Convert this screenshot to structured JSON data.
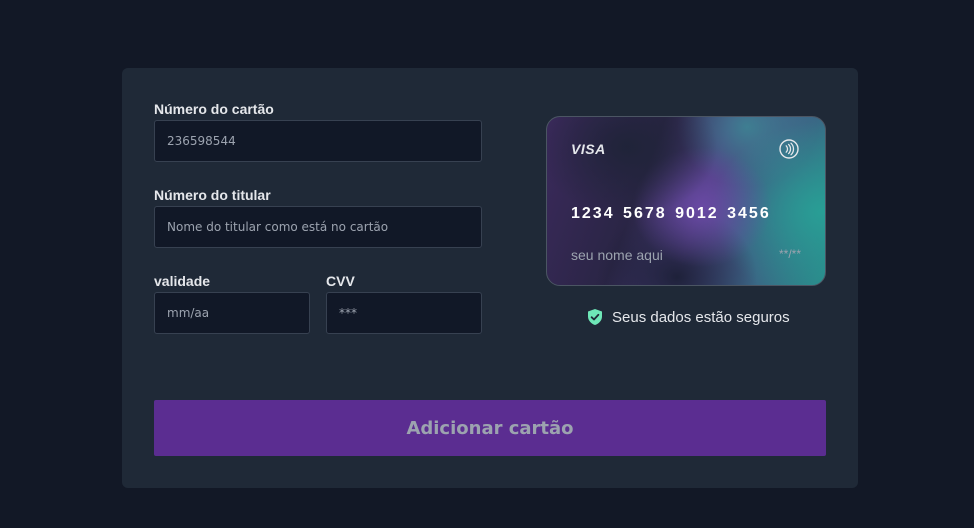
{
  "form": {
    "card_number": {
      "label": "Número do cartão",
      "value": "236598544",
      "placeholder": ""
    },
    "holder": {
      "label": "Número do titular",
      "value": "",
      "placeholder": "Nome do titular como está no cartão"
    },
    "expiry": {
      "label": "validade",
      "value": "",
      "placeholder": "mm/aa"
    },
    "cvv": {
      "label": "CVV",
      "value": "",
      "placeholder": "***"
    }
  },
  "card_preview": {
    "brand": "VISA",
    "number": "1234 5678 9012 3456",
    "holder_name": "seu nome aqui",
    "expiry": "**/**",
    "contactless_icon": "contactless-icon"
  },
  "security": {
    "icon": "shield-check-icon",
    "text": "Seus dados estão seguros",
    "icon_color": "#6ee7b7"
  },
  "submit": {
    "label": "Adicionar cartão"
  },
  "colors": {
    "page_bg": "#121826",
    "panel_bg": "#1f2937",
    "input_bg": "#111827",
    "button_bg": "#5b2d91",
    "accent_teal": "#2a9d8f",
    "accent_purple": "#6b46c1"
  }
}
